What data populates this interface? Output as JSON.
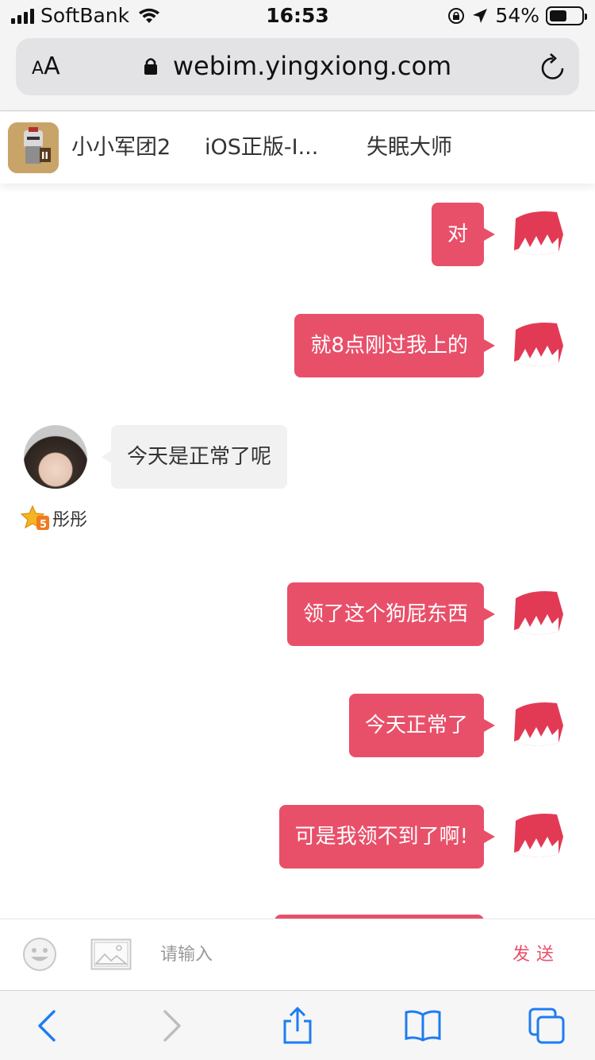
{
  "status_bar": {
    "carrier": "SoftBank",
    "time": "16:53",
    "battery_percent": "54%",
    "battery_level": 0.54
  },
  "browser": {
    "text_size_label_small": "A",
    "text_size_label_large": "A",
    "url": "webim.yingxiong.com"
  },
  "recent_strip": {
    "items": [
      "小小军团2",
      "iOS正版-I...",
      "失眠大师"
    ]
  },
  "chat": {
    "messages": [
      {
        "side": "out",
        "text": "对"
      },
      {
        "side": "out",
        "text": "就8点刚过我上的"
      },
      {
        "side": "in",
        "text": "今天是正常了呢",
        "user": "彤彤",
        "level": "5"
      },
      {
        "side": "out",
        "text": "领了这个狗屁东西"
      },
      {
        "side": "out",
        "text": "今天正常了"
      },
      {
        "side": "out",
        "text": "可是我领不到了啊!"
      }
    ]
  },
  "input_bar": {
    "placeholder": "请输入",
    "send_label": "发送"
  },
  "colors": {
    "accent": "#e8506a",
    "incoming_bubble": "#f1f1f1",
    "ios_blue": "#1e7cf2"
  },
  "icons": {
    "status": [
      "signal-icon",
      "wifi-icon",
      "orientation-lock-icon",
      "location-icon",
      "battery-icon"
    ],
    "browser": [
      "lock-icon",
      "reload-icon"
    ],
    "input": [
      "emoji-icon",
      "image-icon"
    ],
    "toolbar": [
      "back-icon",
      "forward-icon",
      "share-icon",
      "bookmarks-icon",
      "tabs-icon"
    ]
  }
}
